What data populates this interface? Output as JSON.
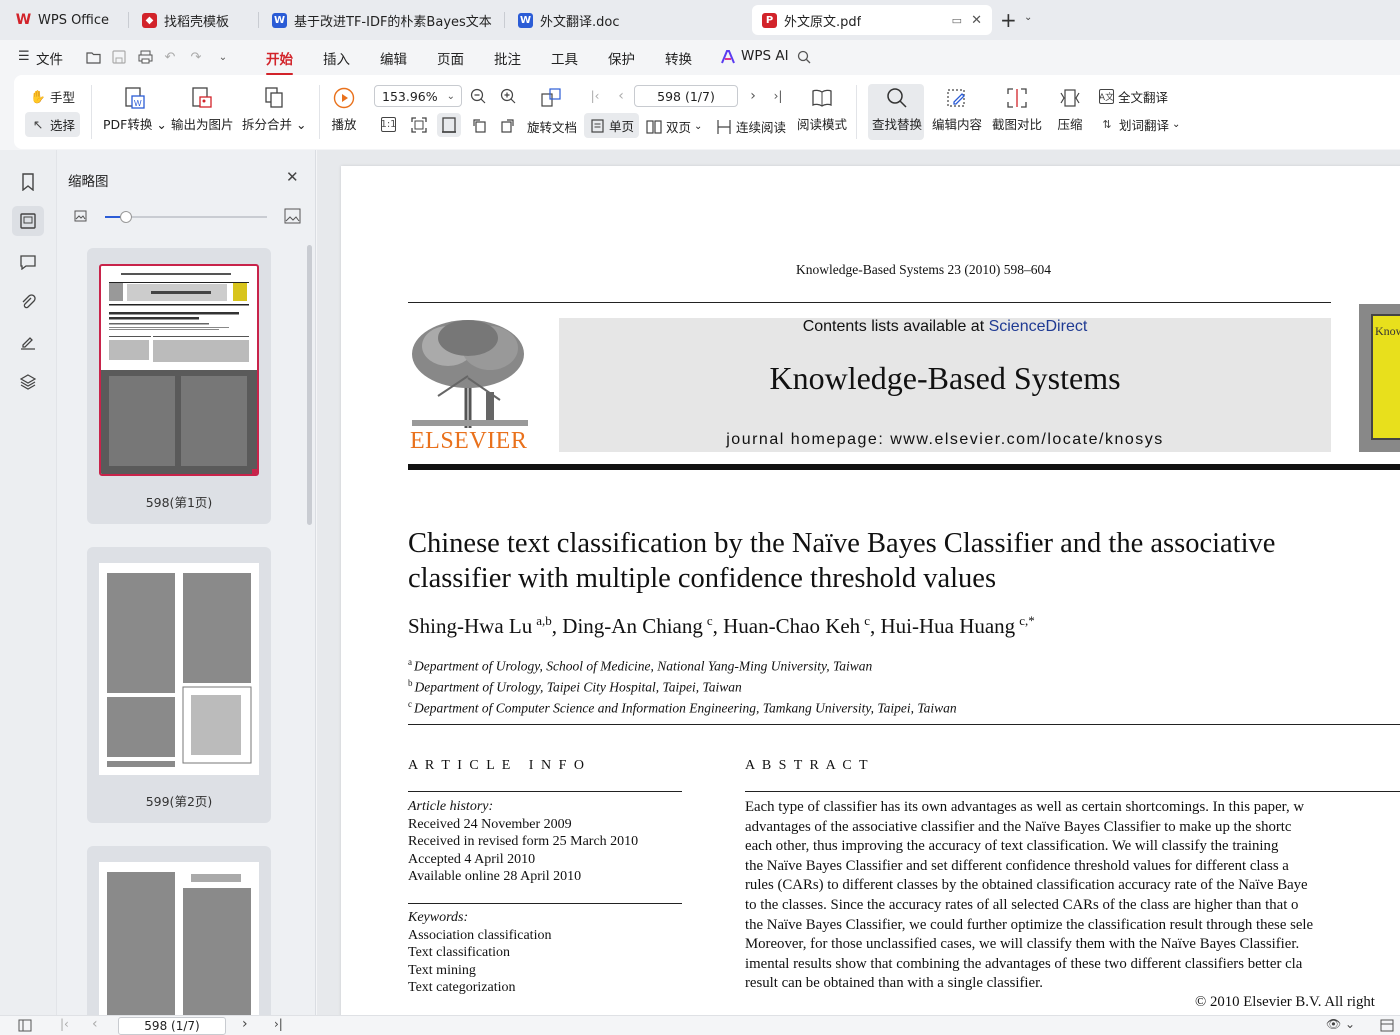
{
  "tabs": [
    {
      "label": "WPS Office",
      "icon": "wps-logo-icon"
    },
    {
      "label": "找稻壳模板",
      "icon": "docer-icon"
    },
    {
      "label": "基于改进TF-IDF的朴素Bayes文本分类",
      "icon": "word-doc-icon"
    },
    {
      "label": "外文翻译.doc",
      "icon": "word-doc-icon"
    },
    {
      "label": "外文原文.pdf",
      "icon": "pdf-icon"
    }
  ],
  "menu": {
    "file": "文件",
    "items": [
      "开始",
      "插入",
      "编辑",
      "页面",
      "批注",
      "工具",
      "保护",
      "转换"
    ],
    "ai": "WPS AI"
  },
  "ribbon": {
    "hand": "手型",
    "select": "选择",
    "pdf_convert": "PDF转换",
    "export_image": "输出为图片",
    "split_merge": "拆分合并",
    "play": "播放",
    "zoom": "153.96%",
    "page_box": "598 (1/7)",
    "rotate": "旋转文档",
    "single": "单页",
    "double": "双页",
    "continuous": "连续阅读",
    "read_mode": "阅读模式",
    "find_replace": "查找替换",
    "edit_content": "编辑内容",
    "compare": "截图对比",
    "compress": "压缩",
    "full_translate": "全文翻译",
    "word_translate": "划词翻译"
  },
  "sidebar": {
    "title": "缩略图",
    "thumbs": [
      {
        "label": "598(第1页)"
      },
      {
        "label": "599(第2页)"
      },
      {
        "label": ""
      }
    ]
  },
  "paper": {
    "journal_ref": "Knowledge-Based Systems 23 (2010) 598–604",
    "contents_prefix": "Contents lists available at ",
    "contents_link": "ScienceDirect",
    "journal_name": "Knowledge-Based Systems",
    "homepage": "journal homepage: www.elsevier.com/locate/knosys",
    "publisher": "ELSEVIER",
    "cover_text": "Know",
    "title_line1": "Chinese text classification by the Naïve Bayes Classifier and the associative",
    "title_line2": "classifier with multiple confidence threshold values",
    "authors": [
      {
        "name": "Shing-Hwa Lu",
        "sup": "a,b",
        "sep": ", "
      },
      {
        "name": "Ding-An Chiang",
        "sup": "c",
        "sep": ", "
      },
      {
        "name": "Huan-Chao Keh",
        "sup": "c",
        "sep": ", "
      },
      {
        "name": "Hui-Hua Huang",
        "sup": "c,*",
        "sep": ""
      }
    ],
    "affiliations": [
      {
        "mark": "a",
        "text": "Department of Urology, School of Medicine, National Yang-Ming University, Taiwan"
      },
      {
        "mark": "b",
        "text": "Department of Urology, Taipei City Hospital, Taipei, Taiwan"
      },
      {
        "mark": "c",
        "text": "Department of Computer Science and Information Engineering, Tamkang University, Taipei, Taiwan"
      }
    ],
    "article_info_heading": "A R T I C L E   I N F O",
    "history_label": "Article history:",
    "history": [
      "Received 24 November 2009",
      "Received in revised form 25 March 2010",
      "Accepted 4 April 2010",
      "Available online 28 April 2010"
    ],
    "keywords_label": "Keywords:",
    "keywords": [
      "Association classification",
      "Text classification",
      "Text mining",
      "Text categorization"
    ],
    "abstract_heading": "A B S T R A C T",
    "abstract_lines": [
      "Each type of classifier has its own advantages as well as certain shortcomings. In this paper, w",
      "advantages of the associative classifier and the Naïve Bayes Classifier to make up the shortc",
      "each other, thus improving the accuracy of text classification. We will classify the training",
      "the Naïve Bayes Classifier and set different confidence threshold values for different class a",
      "rules (CARs) to different classes by the obtained classification accuracy rate of the Naïve Baye",
      "to the classes. Since the accuracy rates of all selected CARs of the class are higher than that o",
      "the Naïve Bayes Classifier, we could further optimize the classification result through these sele",
      "Moreover, for those unclassified cases, we will classify them with the Naïve Bayes Classifier.",
      "imental results show that combining the advantages of these two different classifiers better cla",
      "result can be obtained than with a single classifier."
    ],
    "copyright": "© 2010 Elsevier B.V. All right"
  },
  "status": {
    "page_box": "598 (1/7)"
  },
  "colors": {
    "accent": "#d2232a",
    "elsevier_orange": "#e9711c",
    "link_blue": "#1f3a93"
  }
}
